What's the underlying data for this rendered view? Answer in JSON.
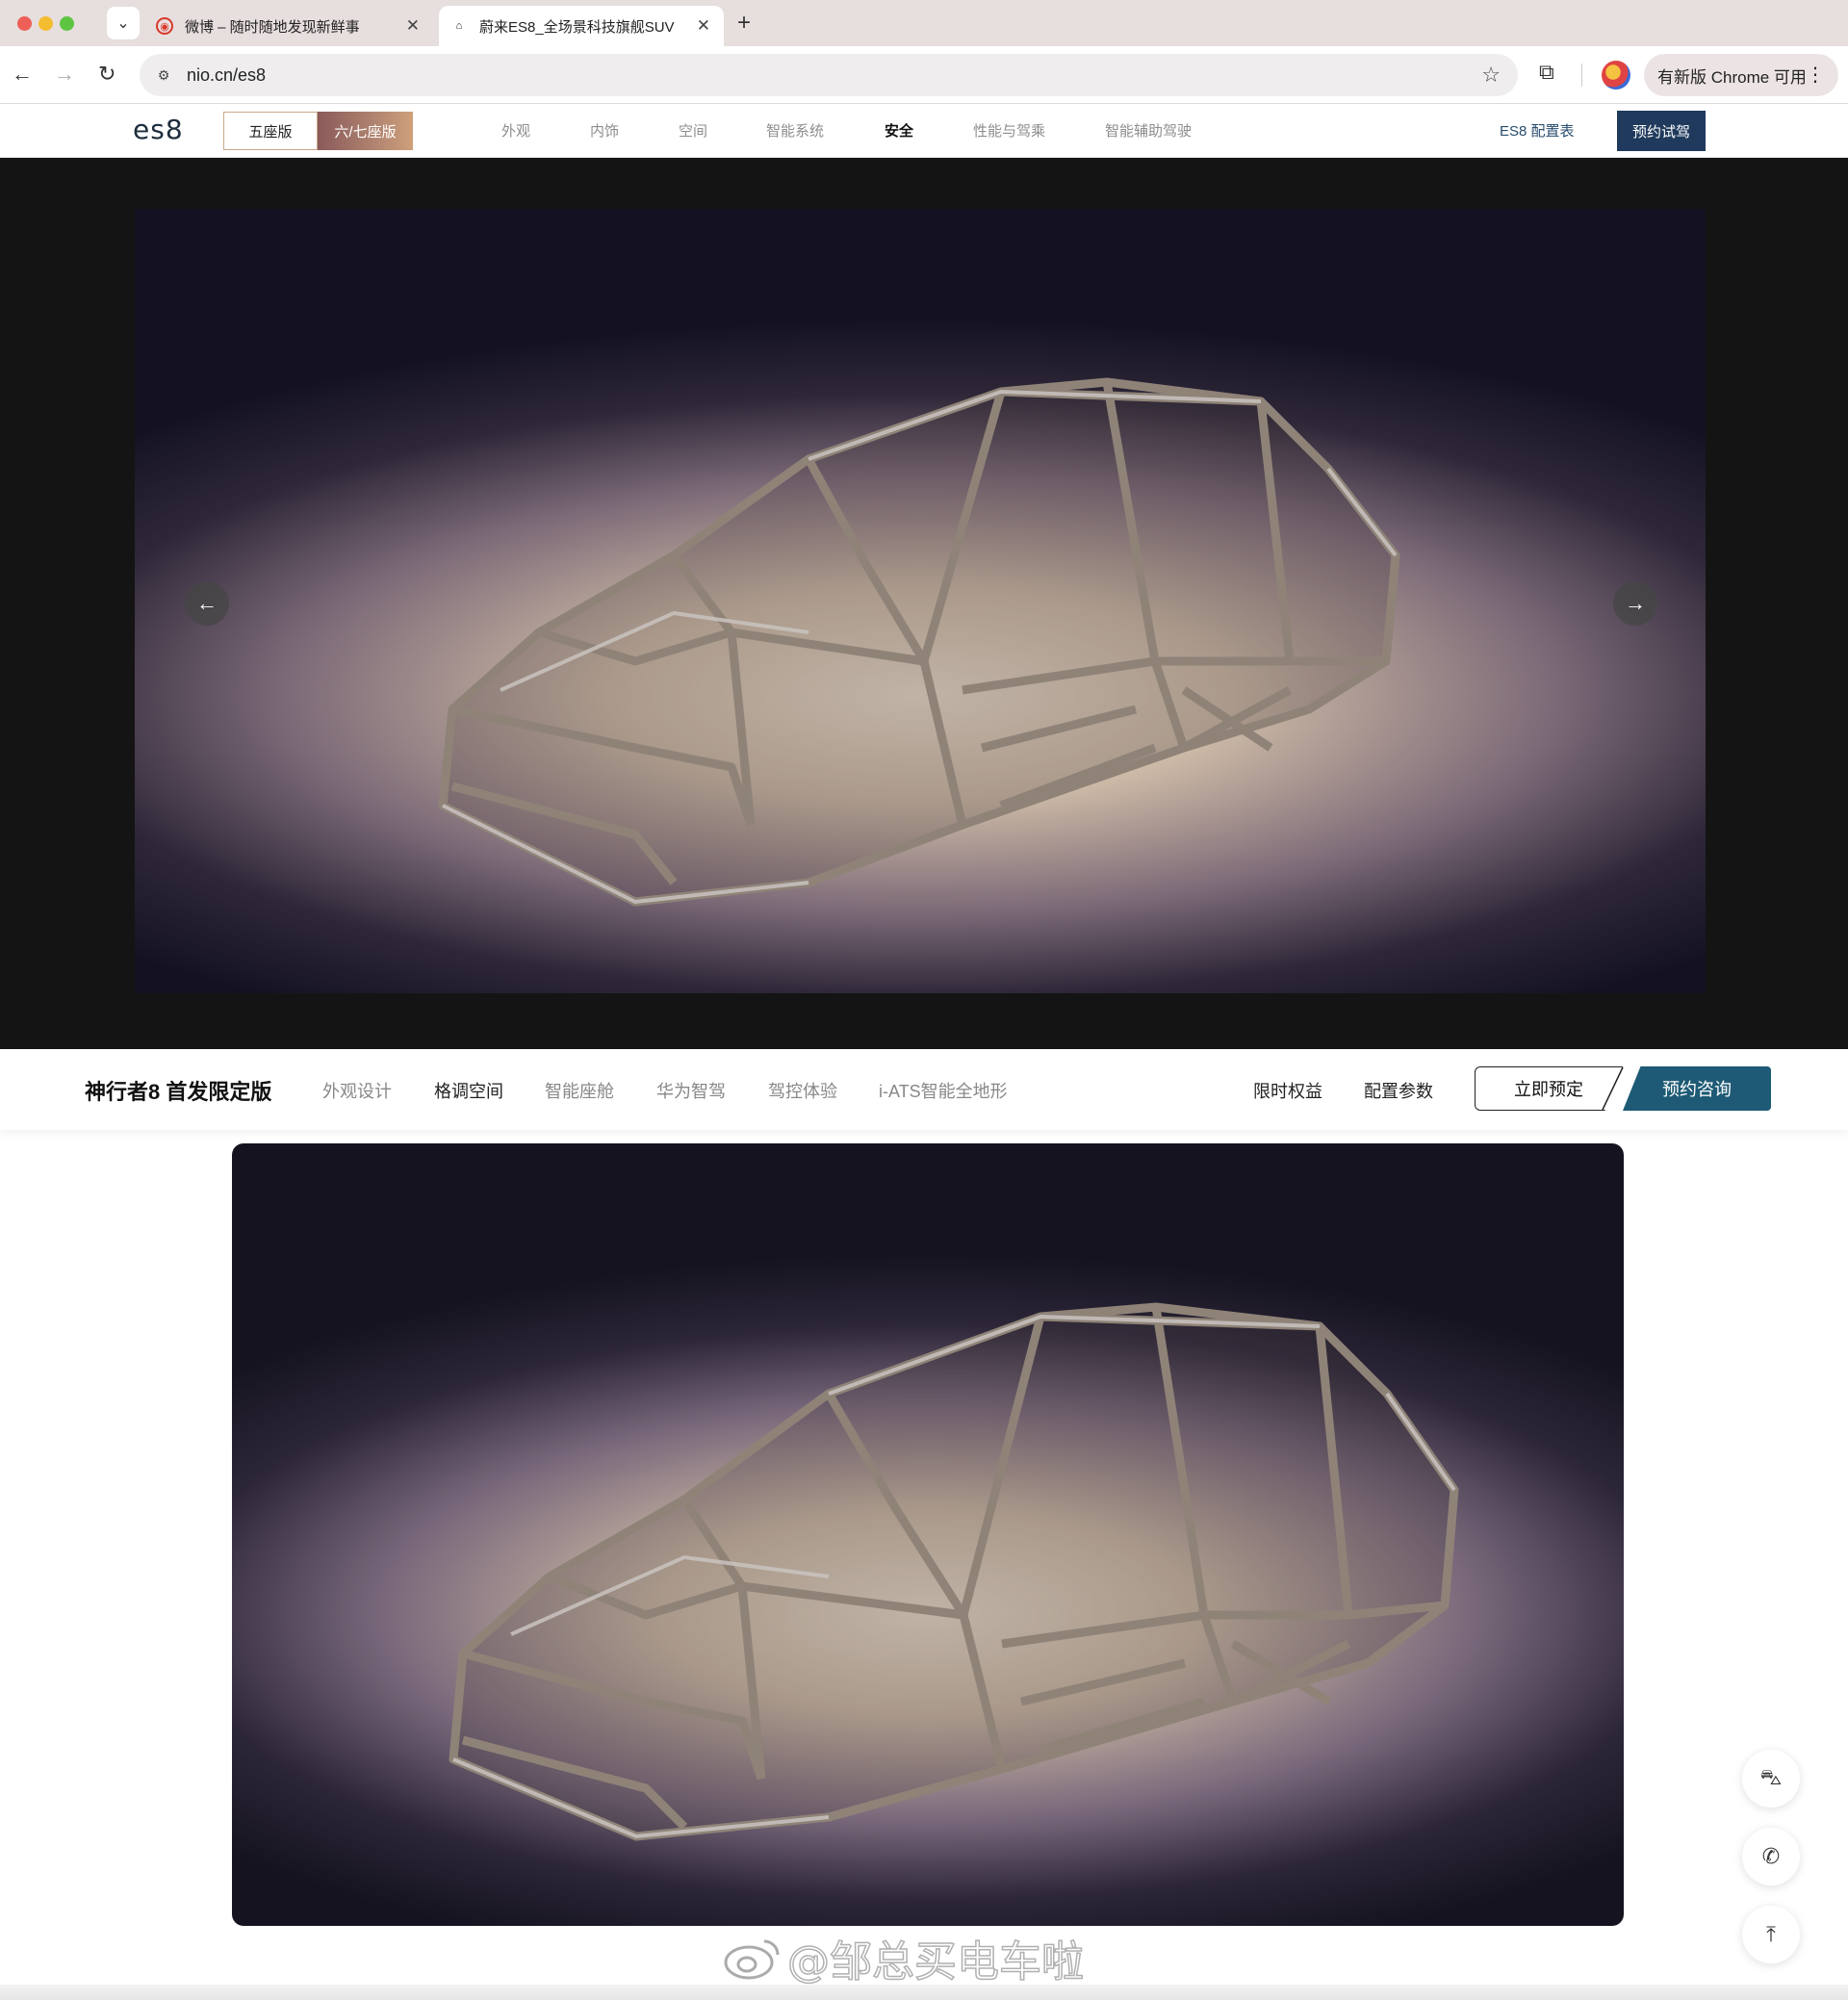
{
  "browser": {
    "tabs": [
      {
        "title": "微博 – 随时随地发现新鲜事",
        "favicon": "weibo-icon"
      },
      {
        "title": "蔚来ES8_全场景科技旗舰SUV",
        "favicon": "nio-icon"
      }
    ],
    "url": "nio.cn/es8",
    "update_chip": "有新版 Chrome 可用"
  },
  "nio_header": {
    "logo": "es8",
    "seat_options": [
      "五座版",
      "六/七座版"
    ],
    "nav": [
      "外观",
      "内饰",
      "空间",
      "智能系统",
      "安全",
      "性能与驾乘",
      "智能辅助驾驶"
    ],
    "active_nav": "安全",
    "config_link": "ES8 配置表",
    "cta": "预约试驾"
  },
  "sub_nav": {
    "model": "神行者8 首发限定版",
    "items": [
      "外观设计",
      "格调空间",
      "智能座舱",
      "华为智驾",
      "驾控体验",
      "i-ATS智能全地形"
    ],
    "right_links": [
      "限时权益",
      "配置参数"
    ],
    "order_button": "立即预定",
    "consult_button": "预约咨询"
  },
  "watermark": "@邹总买电车啦",
  "colors": {
    "nio_cta": "#1f3a5c",
    "consult_cta": "#1e5a75",
    "seat_gradient_start": "#8a5a5a"
  }
}
